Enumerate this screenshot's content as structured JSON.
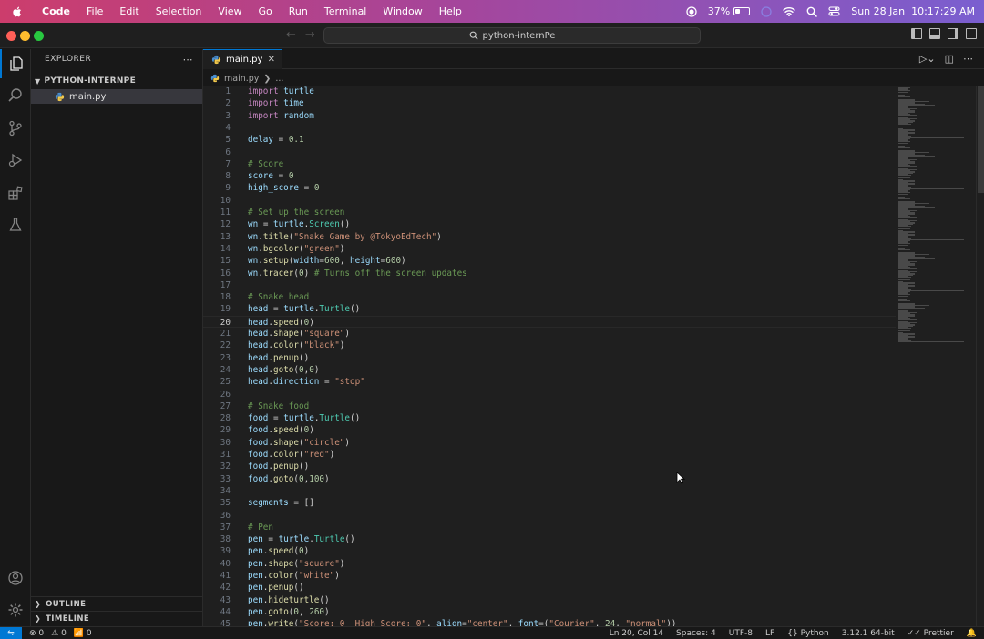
{
  "menubar": {
    "app": "Code",
    "items": [
      "File",
      "Edit",
      "Selection",
      "View",
      "Go",
      "Run",
      "Terminal",
      "Window",
      "Help"
    ],
    "battery_percent": "37%",
    "battery_level": 0.37,
    "datetime": "Sun 28 Jan  10:17:29 AM"
  },
  "titlebar": {
    "command_center": "python-internPe"
  },
  "sidebar": {
    "title": "EXPLORER",
    "folder": "PYTHON-INTERNPE",
    "files": [
      "main.py"
    ],
    "outline": "OUTLINE",
    "timeline": "TIMELINE"
  },
  "tabs": [
    {
      "label": "main.py",
      "active": true
    }
  ],
  "breadcrumb": {
    "file": "main.py",
    "rest": "..."
  },
  "editor": {
    "current_line": 20,
    "lines": [
      "import turtle",
      "import time",
      "import random",
      "",
      "delay = 0.1",
      "",
      "# Score",
      "score = 0",
      "high_score = 0",
      "",
      "# Set up the screen",
      "wn = turtle.Screen()",
      "wn.title(\"Snake Game by @TokyoEdTech\")",
      "wn.bgcolor(\"green\")",
      "wn.setup(width=600, height=600)",
      "wn.tracer(0) # Turns off the screen updates",
      "",
      "# Snake head",
      "head = turtle.Turtle()",
      "head.speed(0)",
      "head.shape(\"square\")",
      "head.color(\"black\")",
      "head.penup()",
      "head.goto(0,0)",
      "head.direction = \"stop\"",
      "",
      "# Snake food",
      "food = turtle.Turtle()",
      "food.speed(0)",
      "food.shape(\"circle\")",
      "food.color(\"red\")",
      "food.penup()",
      "food.goto(0,100)",
      "",
      "segments = []",
      "",
      "# Pen",
      "pen = turtle.Turtle()",
      "pen.speed(0)",
      "pen.shape(\"square\")",
      "pen.color(\"white\")",
      "pen.penup()",
      "pen.hideturtle()",
      "pen.goto(0, 260)",
      "pen.write(\"Score: 0  High Score: 0\", align=\"center\", font=(\"Courier\", 24, \"normal\"))"
    ]
  },
  "statusbar": {
    "errors": "0",
    "warnings": "0",
    "ports": "0",
    "position": "Ln 20, Col 14",
    "spaces": "Spaces: 4",
    "encoding": "UTF-8",
    "eol": "LF",
    "language": "Python",
    "interpreter": "3.12.1 64-bit",
    "formatter": "Prettier"
  },
  "colors": {
    "accent": "#0078d4",
    "editor_bg": "#1f1f1f",
    "keyword": "#c586c0",
    "string": "#ce9178",
    "comment": "#6a9955",
    "function": "#dcdcaa",
    "variable": "#9cdcfe"
  }
}
